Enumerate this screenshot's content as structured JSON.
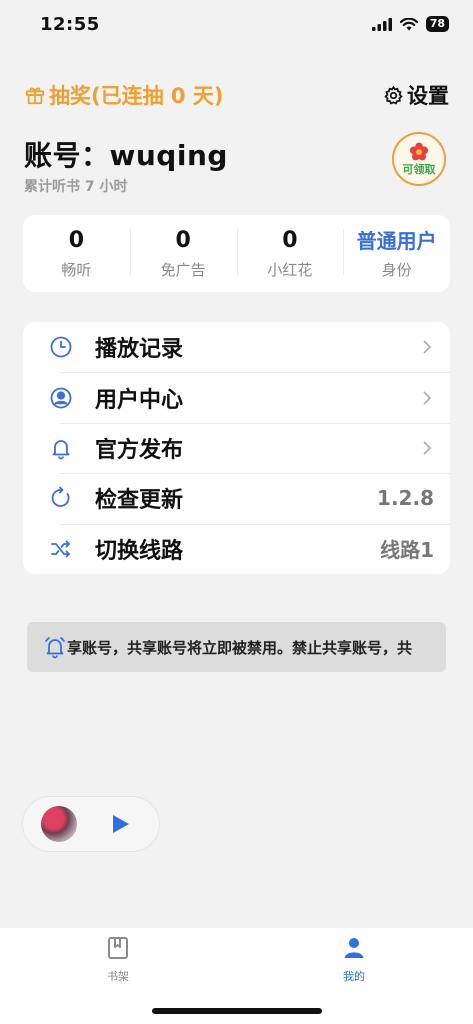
{
  "status_bar": {
    "time": "12:55",
    "battery": "78"
  },
  "header": {
    "lottery_label": "抽奖(已连抽 0 天)",
    "settings_label": "设置"
  },
  "account": {
    "name": "账号：wuqing",
    "listen_time": "累计听书 7 小时",
    "claim_label": "可领取"
  },
  "stats": [
    {
      "value": "0",
      "label": "畅听"
    },
    {
      "value": "0",
      "label": "免广告"
    },
    {
      "value": "0",
      "label": "小红花"
    },
    {
      "value": "普通用户",
      "label": "身份"
    }
  ],
  "menu": [
    {
      "label": "播放记录",
      "right": "",
      "icon": "clock-icon"
    },
    {
      "label": "用户中心",
      "right": "",
      "icon": "user-circle-icon"
    },
    {
      "label": "官方发布",
      "right": "",
      "icon": "bell-icon"
    },
    {
      "label": "检查更新",
      "right": "1.2.8",
      "icon": "refresh-icon"
    },
    {
      "label": "切换线路",
      "right": "线路1",
      "icon": "shuffle-icon"
    }
  ],
  "notice": {
    "text": "享账号，共享账号将立即被禁用。禁止共享账号，共"
  },
  "tabs": {
    "shelf_label": "书架",
    "mine_label": "我的"
  },
  "colors": {
    "accent": "#3b6fd8",
    "lottery": "#f0a030",
    "tab_active": "#2f6fe0"
  }
}
